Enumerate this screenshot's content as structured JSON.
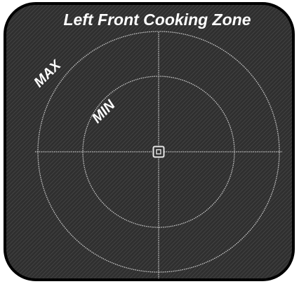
{
  "title": "Left Front Cooking Zone",
  "labels": {
    "max": "MAX",
    "min": "MIN"
  },
  "icons": {
    "center_marker": "center-square-icon"
  },
  "colors": {
    "panel_background": "#2f2f2f",
    "panel_border": "#000000",
    "guide_lines": "#c8c8c8",
    "text": "#ffffff"
  }
}
